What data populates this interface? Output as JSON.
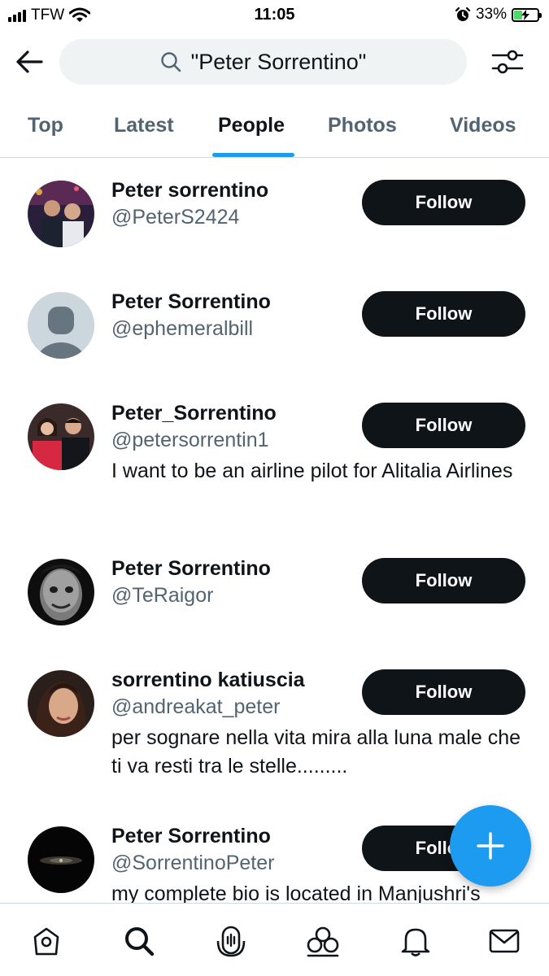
{
  "status_bar": {
    "carrier": "TFW",
    "time": "11:05",
    "battery_percent": "33%",
    "battery_level": 0.33,
    "icons": [
      "signal-bars-icon",
      "wifi-icon",
      "alarm-icon",
      "battery-charging-icon"
    ]
  },
  "top_bar": {
    "back_icon": "arrow-left-icon",
    "search_icon": "search-icon",
    "search_query": "\"Peter Sorrentino\"",
    "filter_icon": "sliders-icon"
  },
  "tabs": [
    {
      "label": "Top",
      "active": false
    },
    {
      "label": "Latest",
      "active": false
    },
    {
      "label": "People",
      "active": true
    },
    {
      "label": "Photos",
      "active": false
    },
    {
      "label": "Videos",
      "active": false
    }
  ],
  "results": [
    {
      "name": "Peter sorrentino",
      "handle": "@PeterS2424",
      "bio": "",
      "follow_label": "Follow"
    },
    {
      "name": "Peter Sorrentino",
      "handle": "@ephemeralbill",
      "bio": "",
      "follow_label": "Follow"
    },
    {
      "name": "Peter_Sorrentino",
      "handle": "@petersorrentin1",
      "bio": "I want to be an airline pilot for Alitalia Airlines",
      "follow_label": "Follow"
    },
    {
      "name": "Peter Sorrentino",
      "handle": "@TeRaigor",
      "bio": "",
      "follow_label": "Follow"
    },
    {
      "name": "sorrentino katiuscia",
      "handle": "@andreakat_peter",
      "bio": "per sognare nella vita mira alla luna male che ti va resti tra le stelle.........",
      "follow_label": "Follow"
    },
    {
      "name": "Peter Sorrentino",
      "handle": "@SorrentinoPeter",
      "bio": "my complete bio is located in Manjushri's",
      "follow_label": "Follow"
    }
  ],
  "fab": {
    "icon": "plus-icon"
  },
  "bottom_nav": [
    {
      "name": "home",
      "icon": "home-icon"
    },
    {
      "name": "search",
      "icon": "search-icon"
    },
    {
      "name": "spaces",
      "icon": "spaces-microphone-icon"
    },
    {
      "name": "communities",
      "icon": "communities-icon"
    },
    {
      "name": "notifications",
      "icon": "bell-icon"
    },
    {
      "name": "messages",
      "icon": "envelope-icon"
    }
  ],
  "colors": {
    "accent": "#1d9bf0",
    "text_primary": "#0f1419",
    "text_secondary": "#536471",
    "follow_button": "#0f1419",
    "search_background": "#eff3f4",
    "divider": "#cfd9de"
  }
}
